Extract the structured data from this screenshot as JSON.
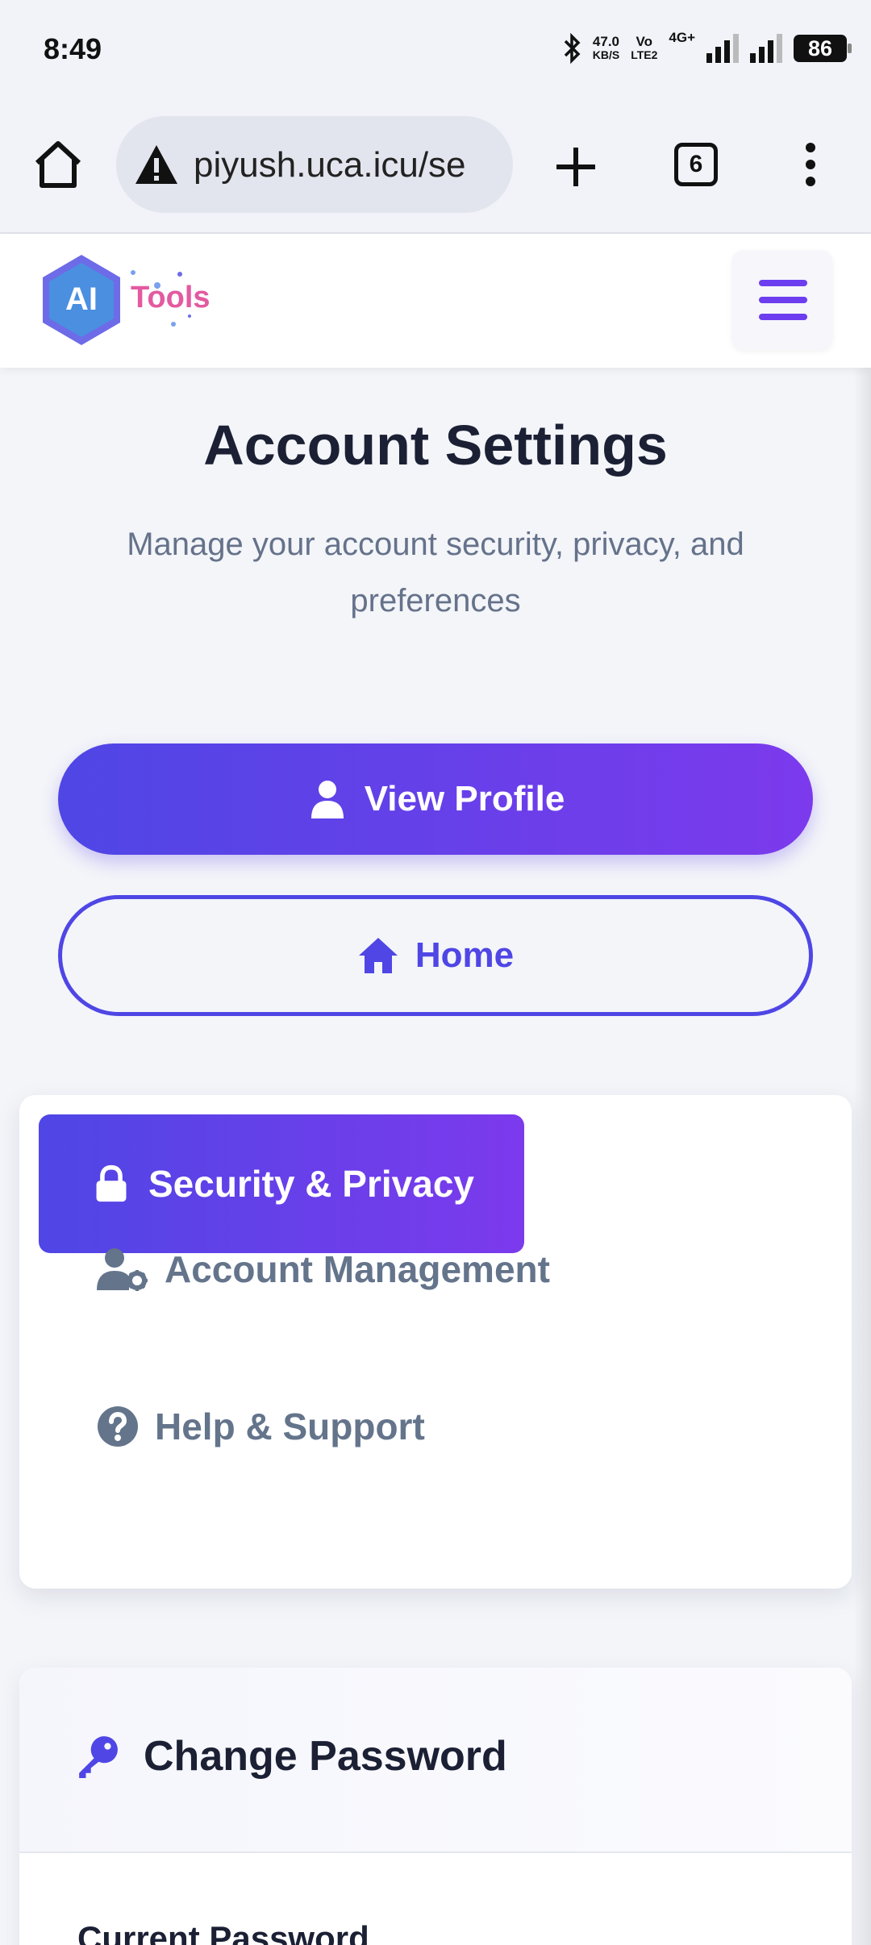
{
  "status_bar": {
    "time": "8:49",
    "net_speed_value": "47.0",
    "net_speed_unit": "KB/S",
    "volte_top": "Vo",
    "volte_bottom": "LTE2",
    "network": "4G+",
    "battery": "86"
  },
  "browser": {
    "url": "piyush.uca.icu/se",
    "tab_count": "6"
  },
  "site": {
    "logo_mark": "AI",
    "logo_text": "Tools"
  },
  "page": {
    "title": "Account Settings",
    "subtitle": "Manage your account security, privacy, and preferences",
    "view_profile_label": "View Profile",
    "home_label": "Home"
  },
  "nav": {
    "items": [
      {
        "label": "Security & Privacy",
        "icon": "lock-icon",
        "active": true
      },
      {
        "label": "Account Management",
        "icon": "user-gear-icon",
        "active": false
      },
      {
        "label": "Help & Support",
        "icon": "question-circle-icon",
        "active": false
      }
    ]
  },
  "change_password": {
    "title": "Change Password",
    "current_password_label": "Current Password"
  },
  "colors": {
    "accent_start": "#4f46e5",
    "accent_end": "#7c3aed",
    "text_dark": "#1b2034",
    "text_muted": "#64748b"
  }
}
